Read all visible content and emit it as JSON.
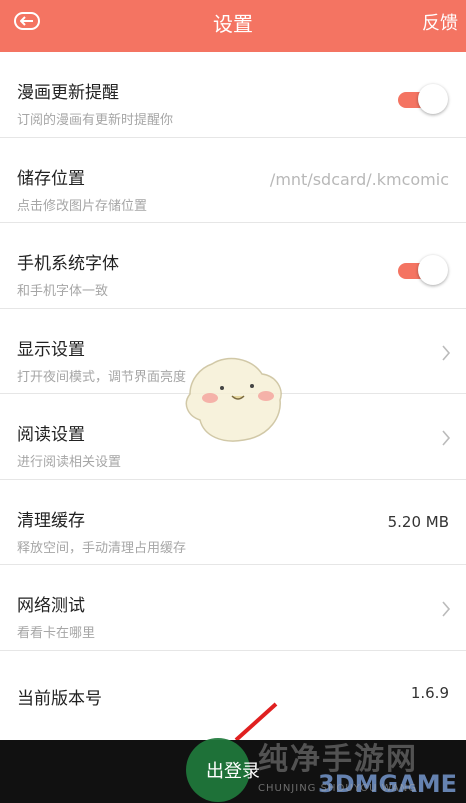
{
  "header": {
    "title": "设置",
    "feedback": "反馈"
  },
  "settings": [
    {
      "title": "漫画更新提醒",
      "subtitle": "订阅的漫画有更新时提醒你",
      "control": "toggle",
      "on": true
    },
    {
      "title": "储存位置",
      "subtitle": "点击修改图片存储位置",
      "value": "/mnt/sdcard/.kmcomic"
    },
    {
      "title": "手机系统字体",
      "subtitle": "和手机字体一致",
      "control": "toggle",
      "on": true
    },
    {
      "title": "显示设置",
      "subtitle": "打开夜间模式，调节界面亮度",
      "control": "chevron"
    },
    {
      "title": "阅读设置",
      "subtitle": "进行阅读相关设置",
      "control": "chevron"
    },
    {
      "title": "清理缓存",
      "subtitle": "释放空间，手动清理占用缓存",
      "value": "5.20 MB"
    },
    {
      "title": "网络测试",
      "subtitle": "看看卡在哪里",
      "control": "chevron"
    },
    {
      "title": "当前版本号",
      "value": "1.6.9"
    }
  ],
  "bottom": {
    "logout": "出登录"
  },
  "watermark": {
    "text": "纯净手游网",
    "brand": "3DMGAME",
    "sub": "CHUNJING SHOUYOU WANG"
  },
  "colors": {
    "accent": "#f47462",
    "bottom_bar": "#111111"
  }
}
